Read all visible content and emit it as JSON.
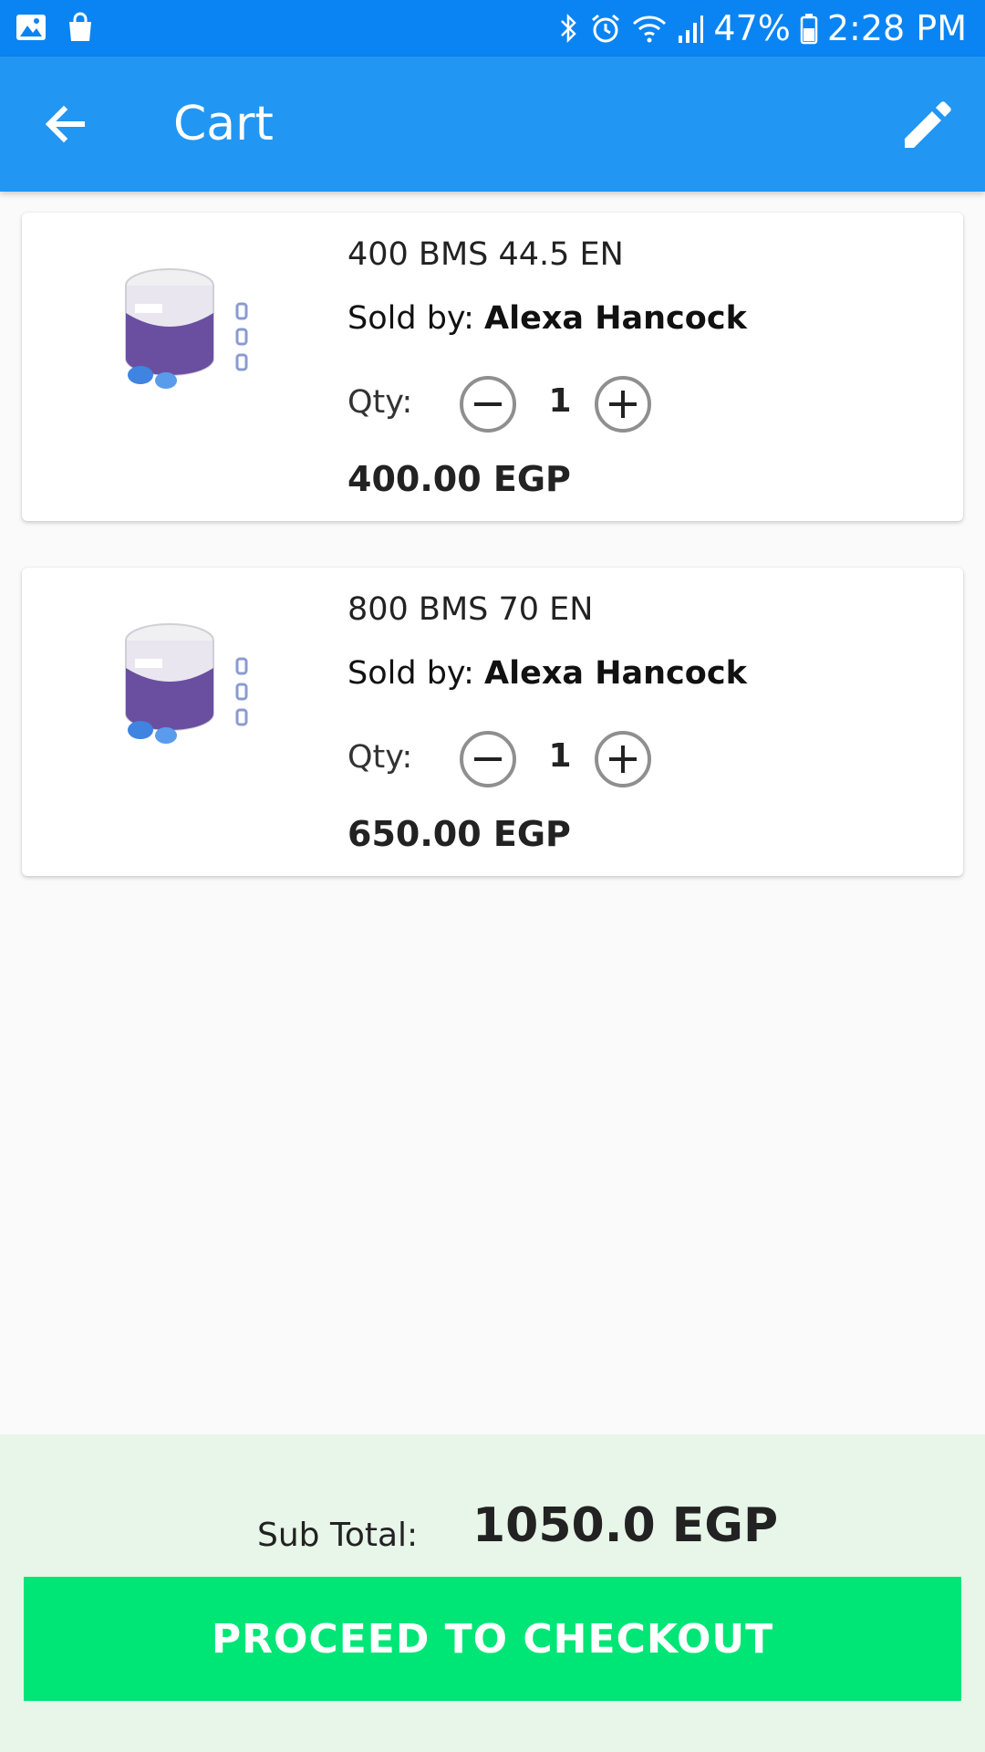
{
  "status_bar": {
    "battery": "47%",
    "time": "2:28 PM",
    "left_icons": [
      "gallery-icon",
      "shopping-bag-icon"
    ],
    "right_icons": [
      "bluetooth-icon",
      "alarm-icon",
      "wifi-icon",
      "signal-icon",
      "battery-icon"
    ]
  },
  "app_bar": {
    "title": "Cart",
    "back_icon": "arrow-back-icon",
    "edit_icon": "pencil-icon",
    "color": "#2196f3"
  },
  "cart": {
    "items": [
      {
        "name": "400 BMS 44.5 EN",
        "sold_by_label": "Sold by:",
        "seller": "Alexa Hancock",
        "qty_label": "Qty:",
        "qty": "1",
        "price": "400.00 EGP"
      },
      {
        "name": "800 BMS 70 EN",
        "sold_by_label": "Sold by:",
        "seller": "Alexa Hancock",
        "qty_label": "Qty:",
        "qty": "1",
        "price": "650.00 EGP"
      }
    ]
  },
  "summary": {
    "subtotal_label": "Sub Total:",
    "subtotal_value": "1050.0 EGP",
    "checkout_label": "PROCEED TO CHECKOUT",
    "checkout_color": "#00e676",
    "panel_color": "#e8f5e9"
  }
}
